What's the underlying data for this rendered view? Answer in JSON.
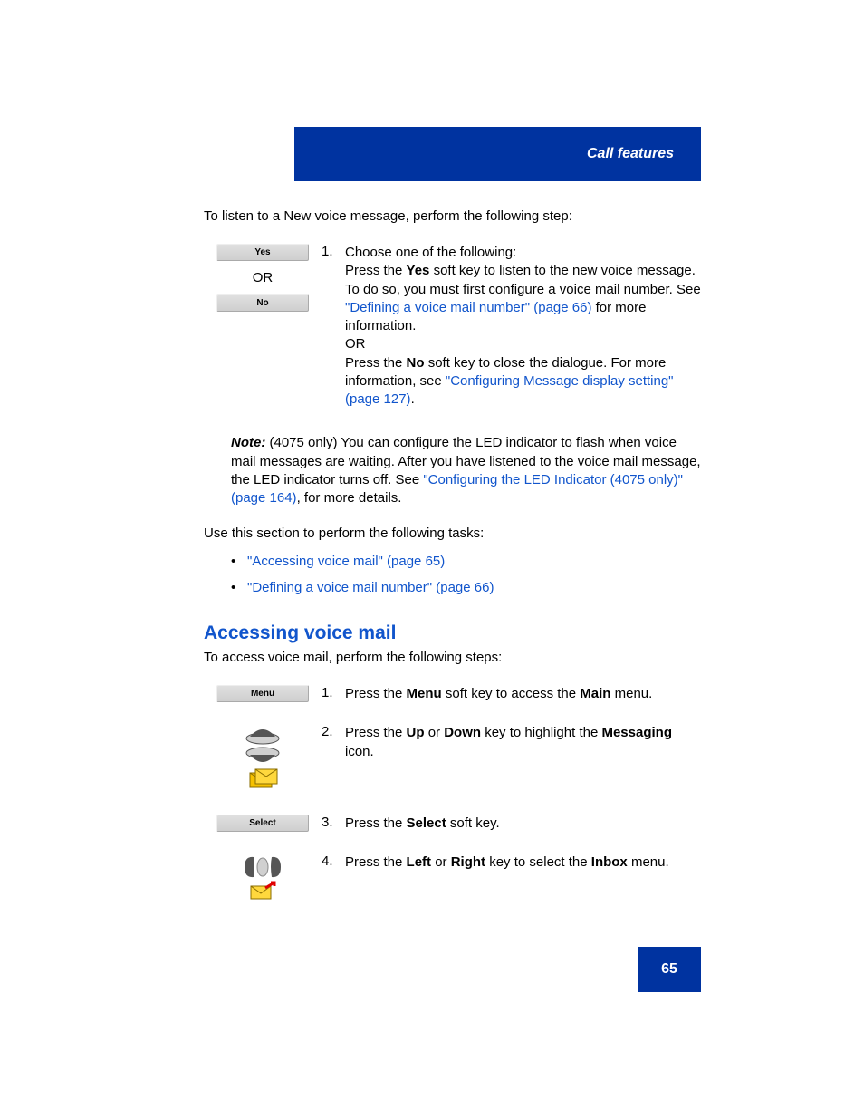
{
  "header": {
    "title": "Call features"
  },
  "intro": "To listen to a New voice message, perform the following step:",
  "s1": {
    "btnYes": "Yes",
    "or": "OR",
    "btnNo": "No",
    "num": "1.",
    "lead": "Choose one of the following:",
    "pressThe1": "Press the ",
    "yesBold": "Yes",
    "afterYes": " soft key to listen to the new voice message. To do so, you must first configure a voice mail number. See ",
    "link1": "\"Defining a voice mail number\" (page 66)",
    "afterLink1": " for more information.",
    "orInline": "OR",
    "pressThe2": "Press the ",
    "noBold": "No",
    "afterNo": " soft key to close the dialogue. For more information, see ",
    "link2": "\"Configuring Message display setting\" (page 127)",
    "dot": "."
  },
  "note": {
    "lead": "Note:",
    "t1": " (4075 only) You can configure the LED indicator to flash when voice mail messages are waiting. After you have listened to the voice mail message, the LED indicator turns off. See ",
    "link": "\"Configuring the LED Indicator (4075 only)\" (page 164)",
    "t2": ", for more details."
  },
  "tasksIntro": "Use this section to perform the following tasks:",
  "b1": "\"Accessing voice mail\" (page 65)",
  "b2": "\"Defining a voice mail number\" (page 66)",
  "heading": "Accessing voice mail",
  "intro2": "To access voice mail, perform the following steps:",
  "p1": {
    "btn": "Menu",
    "num": "1.",
    "a": "Press the ",
    "b": "Menu",
    "c": " soft key to access the ",
    "d": "Main",
    "e": " menu."
  },
  "p2": {
    "num": "2.",
    "a": "Press the ",
    "up": "Up",
    "or": " or ",
    "down": "Down",
    "b": " key to highlight the ",
    "msg": "Messaging",
    "c": " icon."
  },
  "p3": {
    "btn": "Select",
    "num": "3.",
    "a": "Press the ",
    "b": "Select",
    "c": " soft key."
  },
  "p4": {
    "num": "4.",
    "a": "Press the ",
    "l": "Left",
    "or": " or ",
    "r": "Right",
    "b": " key to select the ",
    "inbox": "Inbox",
    "c": " menu."
  },
  "pageNum": "65"
}
